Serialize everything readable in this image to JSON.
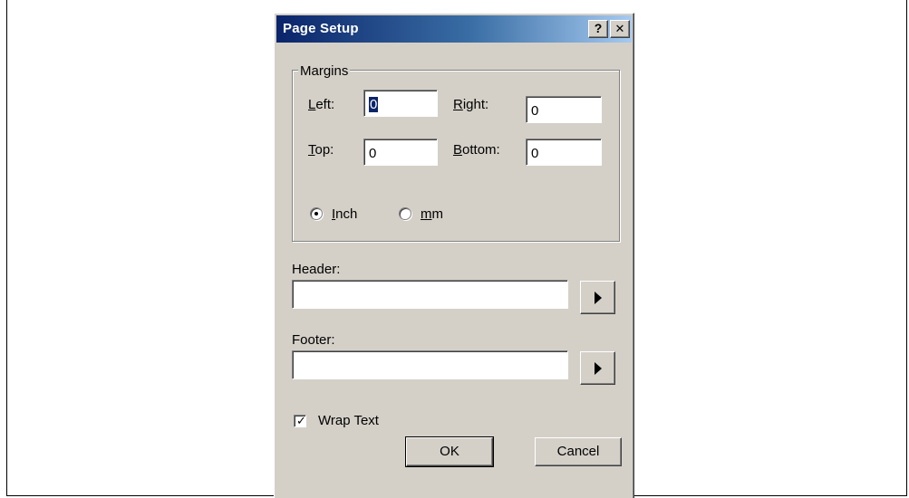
{
  "dialog": {
    "title": "Page Setup",
    "help_button": "?",
    "close_button": "✕"
  },
  "margins": {
    "group_label": "Margins",
    "left_label_prefix": "L",
    "left_label_rest": "eft:",
    "left_value": "0",
    "right_label_prefix": "R",
    "right_label_rest": "ight:",
    "right_value": "0",
    "top_label_prefix": "T",
    "top_label_rest": "op:",
    "top_value": "0",
    "bottom_label_prefix": "B",
    "bottom_label_rest": "ottom:",
    "bottom_value": "0",
    "units": {
      "inch_label_prefix": "I",
      "inch_label_rest": "nch",
      "mm_label_prefix": "m",
      "mm_label_rest": "m",
      "selected": "inch"
    }
  },
  "header": {
    "label": "Header:",
    "value": "",
    "icon": "play-right-arrow-icon"
  },
  "footer": {
    "label": "Footer:",
    "value": "",
    "icon": "play-right-arrow-icon"
  },
  "wrap_text": {
    "label": "Wrap Text",
    "checked": true
  },
  "buttons": {
    "ok_label": "OK",
    "cancel_label": "Cancel"
  }
}
